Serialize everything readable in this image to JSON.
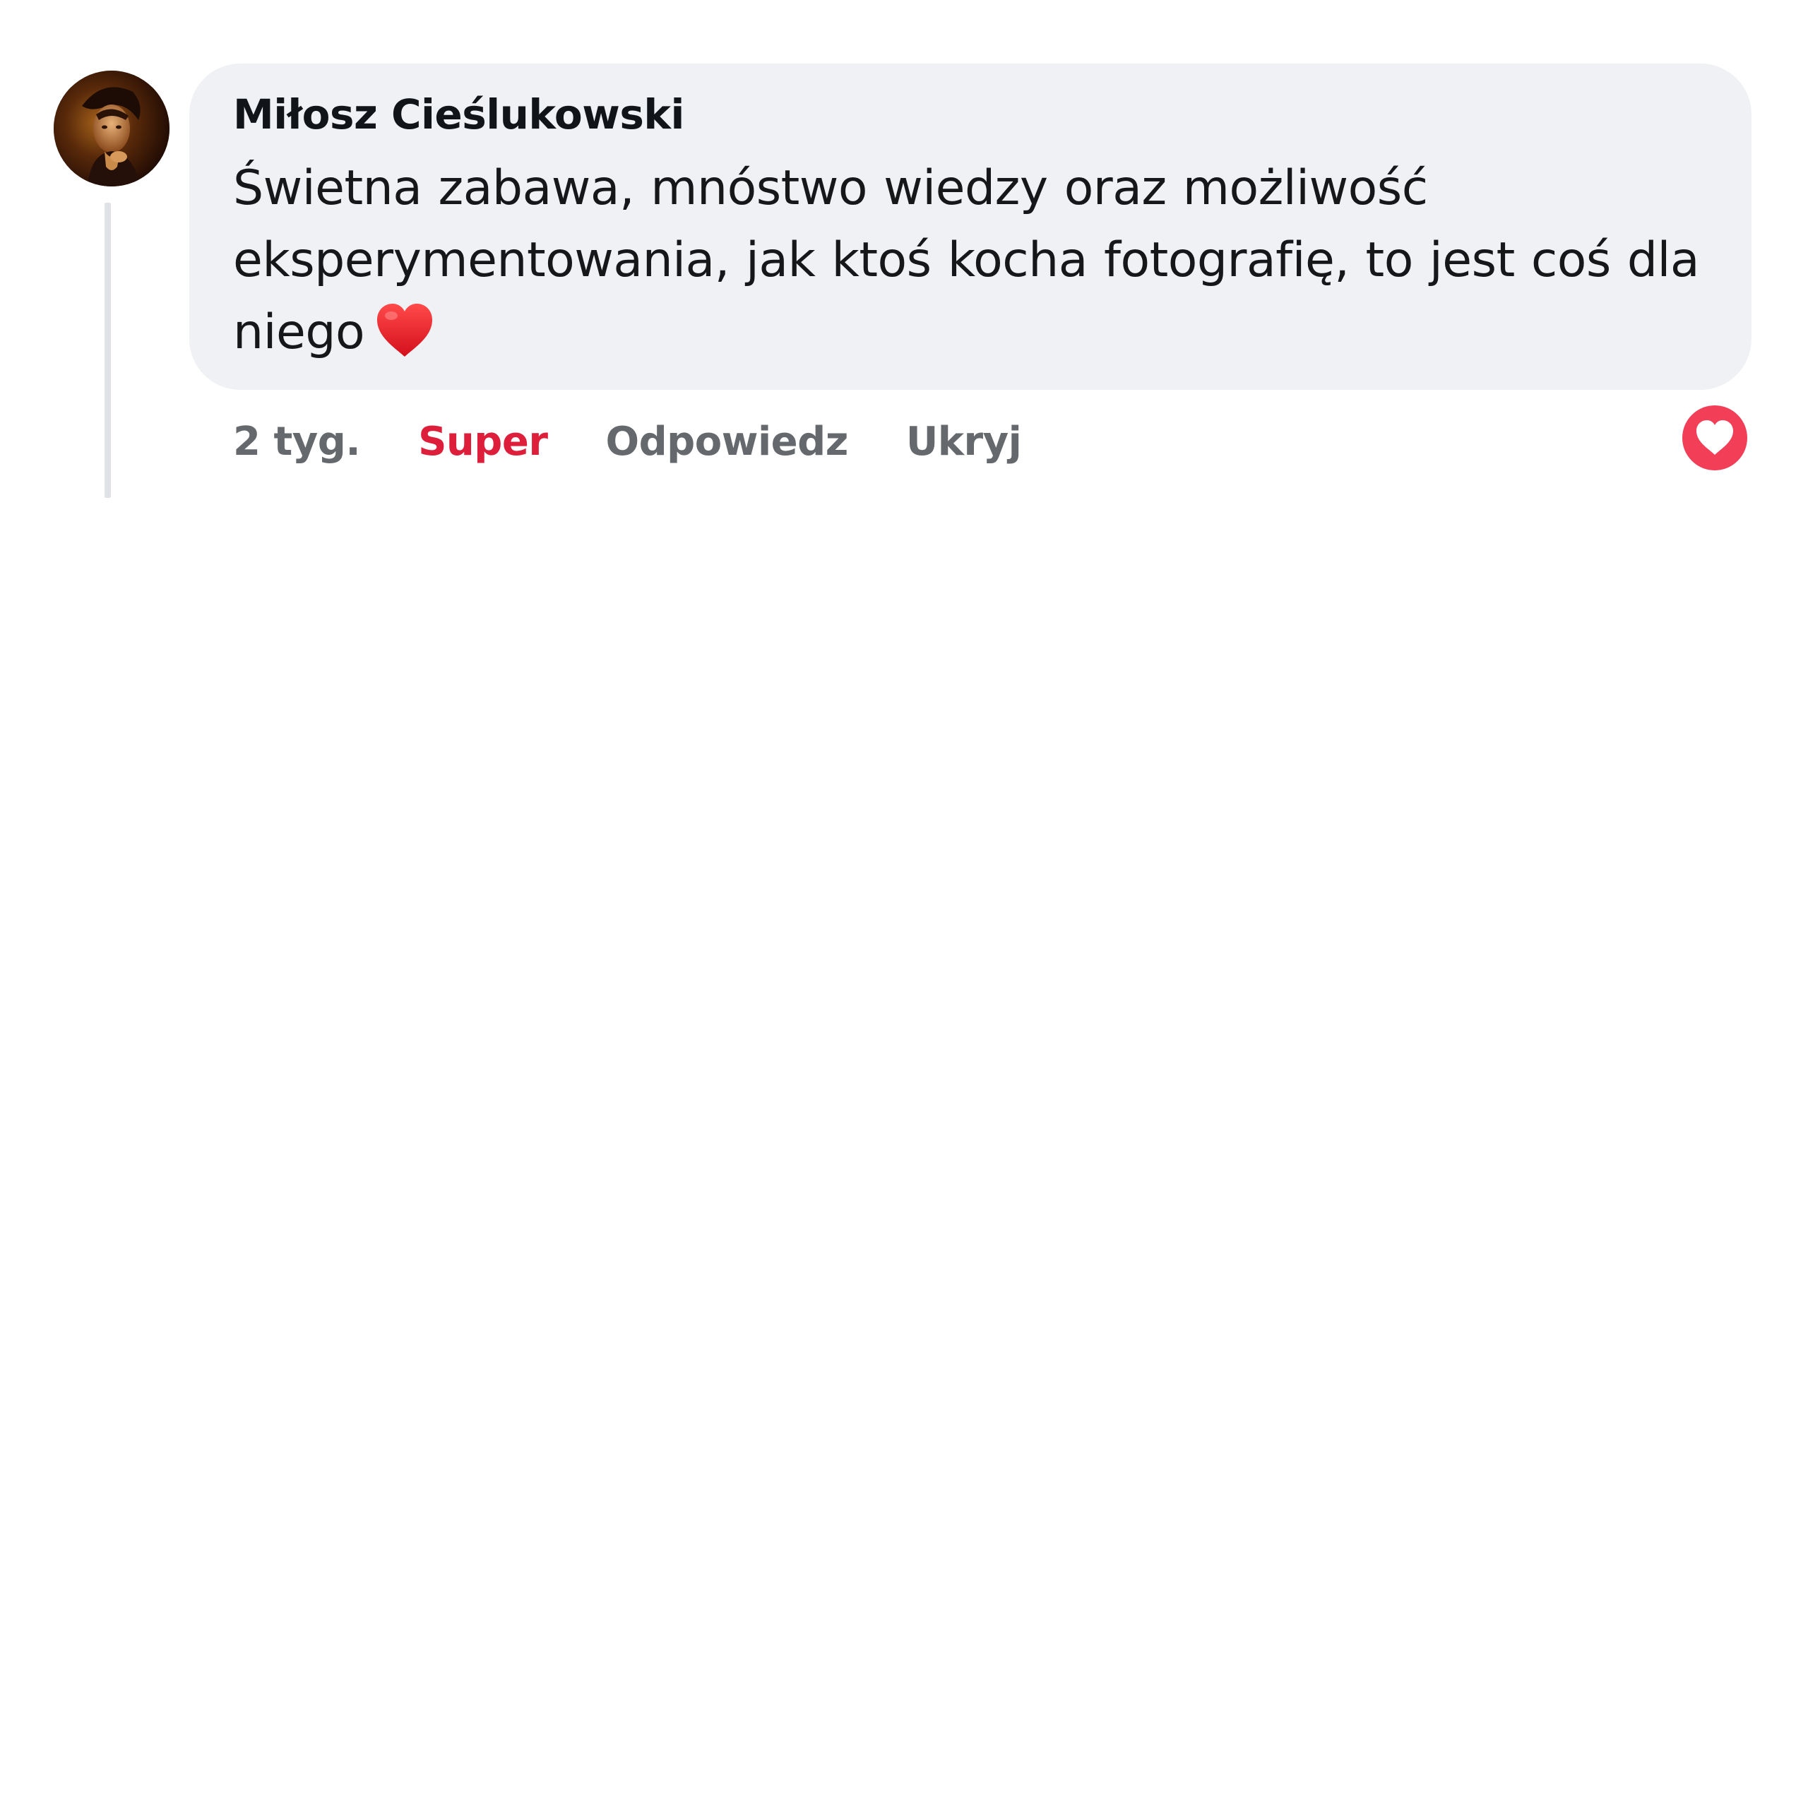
{
  "comment": {
    "author": "Miłosz Cieślukowski",
    "text": "Świetna zabawa, mnóstwo wiedzy oraz możliwość eksperymentowania, jak ktoś kocha fotografię, to jest coś dla niego",
    "emoji": "❤️",
    "avatar_icon": "user-avatar-photo",
    "actions": {
      "time": "2 tyg.",
      "react_label": "Super",
      "reply_label": "Odpowiedz",
      "hide_label": "Ukryj"
    },
    "reaction": {
      "type": "love",
      "icon": "heart-icon",
      "color": "#f33e58"
    },
    "colors": {
      "bubble": "#f0f1f4",
      "active_reaction": "#de1f3b",
      "muted": "#65686c"
    }
  }
}
